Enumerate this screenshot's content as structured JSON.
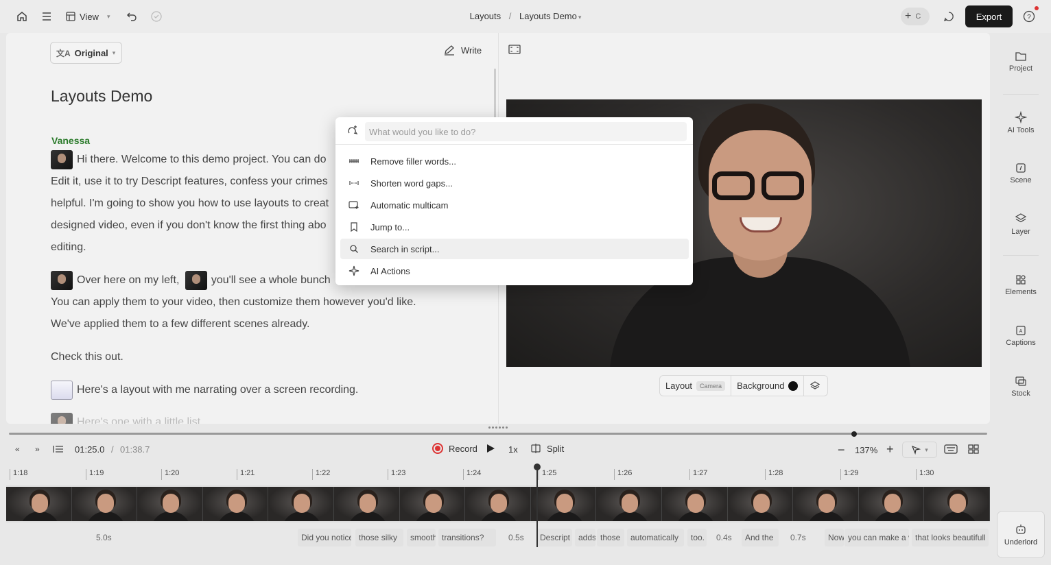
{
  "topbar": {
    "view_label": "View",
    "breadcrumb_parent": "Layouts",
    "breadcrumb_sep": "/",
    "breadcrumb_current": "Layouts Demo",
    "collab_initial": "C",
    "export_label": "Export"
  },
  "script": {
    "language_label": "Original",
    "write_label": "Write",
    "title": "Layouts Demo",
    "speaker": "Vanessa",
    "lines": [
      "Hi there. Welcome to this demo project. You can do",
      "Edit it, use it to try Descript features, confess your crimes",
      "helpful. I'm going to show you how to use layouts to creat",
      "designed video, even if you don't know the first thing abo",
      "editing.",
      "Over here on my left,",
      "you'll see a whole bunch",
      "You can apply them to your video, then customize them however you'd like.",
      "We've applied them to a few different scenes already.",
      "Check this out.",
      "Here's a layout with me narrating over a screen recording.",
      "Here's one with a little list"
    ]
  },
  "preview": {
    "layout_label": "Layout",
    "layout_value": "Camera",
    "background_label": "Background",
    "background_color": "#111111"
  },
  "rail": {
    "items": [
      "Project",
      "AI Tools",
      "Scene",
      "Layer",
      "Elements",
      "Captions",
      "Stock"
    ],
    "underlord_label": "Underlord"
  },
  "timeline": {
    "current_time": "01:25.0",
    "separator": "/",
    "total_time": "01:38.7",
    "record_label": "Record",
    "speed_label": "1x",
    "split_label": "Split",
    "zoom_label": "137%",
    "ruler_ticks": [
      "1:18",
      "1:19",
      "1:20",
      "1:21",
      "1:22",
      "1:23",
      "1:24",
      "1:25",
      "1:26",
      "1:27",
      "1:28",
      "1:29",
      "1:30"
    ],
    "words": [
      "Did you notice",
      "those silky",
      "smooth",
      "transitions?",
      "Descript",
      "adds",
      "those",
      "automatically",
      "too.",
      "And the",
      "Now",
      "you can make a v",
      "that looks beautifull"
    ],
    "gaps": [
      "5.0s",
      "0.5s",
      "0.4s",
      "0.7s"
    ],
    "scrub_position": 0.864
  },
  "palette": {
    "placeholder": "What would you like to do?",
    "items": [
      {
        "label": "Remove filler words...",
        "icon": "filler-words-icon"
      },
      {
        "label": "Shorten word gaps...",
        "icon": "word-gap-icon"
      },
      {
        "label": "Automatic multicam",
        "icon": "multicam-icon"
      },
      {
        "label": "Jump to...",
        "icon": "bookmark-icon"
      },
      {
        "label": "Search in script...",
        "icon": "search-icon"
      },
      {
        "label": "AI Actions",
        "icon": "sparkle-icon"
      }
    ],
    "active_index": 4
  },
  "colors": {
    "accent_record": "#dd3333",
    "speaker_green": "#2a7a2a",
    "export_bg": "#1a1a1a"
  }
}
